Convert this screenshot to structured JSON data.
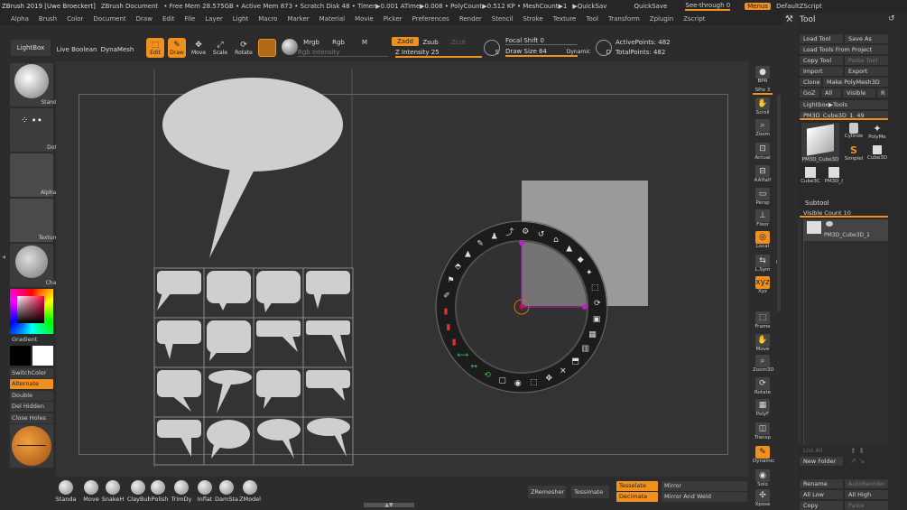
{
  "titlebar": {
    "app": "ZBrush 2019 [Uwe Broeckert]",
    "doc": "ZBrush Document",
    "mem": "• Free Mem 28.575GB • Active Mem 873 • Scratch Disk 48 • Timer▶0.001 ATime▶0.008 • PolyCount▶0.512 KP • MeshCount▶1",
    "quicksave": "▶QuickSav",
    "quicksave2": "QuickSave",
    "seethrough": "See-through  0",
    "menus": "Menus",
    "script": "DefaultZScript"
  },
  "menu": [
    "Alpha",
    "Brush",
    "Color",
    "Document",
    "Draw",
    "Edit",
    "File",
    "Layer",
    "Light",
    "Macro",
    "Marker",
    "Material",
    "Movie",
    "Picker",
    "Preferences",
    "Render",
    "Stencil",
    "Stroke",
    "Texture",
    "Tool",
    "Transform",
    "Zplugin",
    "Zscript"
  ],
  "toolbar": {
    "lightbox": "LightBox",
    "liveboolean": "Live Boolean",
    "dynamesh": "DynaMesh",
    "edit": "Edit",
    "draw": "Draw",
    "move": "Move",
    "scale": "Scale",
    "rotate": "Rotate",
    "mrgb": "Mrgb",
    "rgb": "Rgb",
    "m": "M",
    "rgbint": "Rgb Intensity",
    "zadd": "Zadd",
    "zsub": "Zsub",
    "zcut": "Zcut",
    "zint": "Z Intensity 25",
    "focal": "Focal Shift 0",
    "drawsize": "Draw Size 64",
    "dynamic": "Dynamic",
    "active": "ActivePoints: 482",
    "total": "TotalPoints: 482",
    "s": "S",
    "d": "D"
  },
  "left": {
    "standard": "Standard",
    "dots": "Dots",
    "alpha": "Alpha Off",
    "texture": "Texture Off",
    "chalk": "Chalk",
    "gradient": "Gradient",
    "switch": "SwitchColor",
    "alternate": "Alternate",
    "double": "Double",
    "delhidden": "Del Hidden",
    "closeholes": "Close Holes"
  },
  "right": [
    "BPR",
    "SPix 3",
    "Scroll",
    "Zoom",
    "Actual",
    "AAHalf",
    "Persp",
    "Floor",
    "Local",
    "L.Sym",
    "Xyz",
    "Frame",
    "Move",
    "Zoom3D",
    "Rotate",
    "PolyF",
    "Transp",
    "Dynamic",
    "Solo",
    "Xpose"
  ],
  "tool": {
    "title": "Tool",
    "load": "Load Tool",
    "saveas": "Save As",
    "loadproject": "Load Tools From Project",
    "copy": "Copy Tool",
    "paste": "Paste Tool",
    "import": "Import",
    "export": "Export",
    "clone": "Clone",
    "makepoly": "Make PolyMesh3D",
    "goz": "GoZ",
    "all": "All",
    "visible": "Visible",
    "r": "R",
    "lightbox": "Lightbox▶Tools",
    "current": "PM3D_Cube3D_1. 49",
    "cyl": "Cylinde",
    "polyme": "PolyMe",
    "simple": "SimpleI",
    "cube3d": "Cube3D",
    "pm3d": "PM3D_Cube3D",
    "cube3c": "Cube3C",
    "pm3d2": "PM3D_(",
    "subtool": "Subtool",
    "viscount": "Visible Count 10",
    "subname": "PM3D_Cube3D_1",
    "listall": "List All",
    "newfolder": "New Folder",
    "rename": "Rename",
    "autoreorder": "AutoReorder",
    "alllow": "All Low",
    "allhigh": "All High",
    "copy2": "Copy",
    "paste2": "Paste"
  },
  "bottom": {
    "brushes": [
      "Standa",
      "Move",
      "SnakeH",
      "ClayBui",
      "hPolish",
      "TrimDy",
      "Inflat",
      "DamSta",
      "ZModel"
    ],
    "zremesher": "ZRemesher",
    "tessimate": "Tessimate",
    "tesselate": "Tesselate",
    "decimate": "Decimate",
    "mirror": "Mirror",
    "mirrorweld": "Mirror And Weld"
  }
}
